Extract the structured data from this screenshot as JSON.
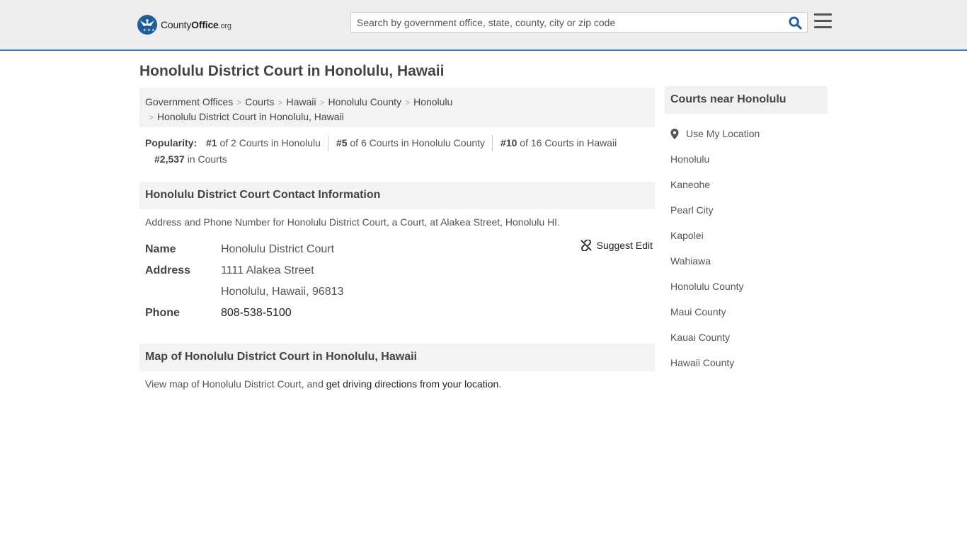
{
  "header": {
    "logo": {
      "part1": "County",
      "part2": "Office",
      "part3": ".org"
    },
    "search_placeholder": "Search by government office, state, county, city or zip code"
  },
  "page_title": "Honolulu District Court in Honolulu, Hawaii",
  "breadcrumb": {
    "items": [
      "Government Offices",
      "Courts",
      "Hawaii",
      "Honolulu County",
      "Honolulu"
    ],
    "current": "Honolulu District Court in Honolulu, Hawaii",
    "separator": ">"
  },
  "popularity": {
    "label": "Popularity:",
    "items": [
      {
        "rank": "#1",
        "text": "of 2 Courts in Honolulu"
      },
      {
        "rank": "#5",
        "text": "of 6 Courts in Honolulu County"
      },
      {
        "rank": "#10",
        "text": "of 16 Courts in Hawaii"
      },
      {
        "rank": "#2,537",
        "text": "in Courts"
      }
    ]
  },
  "contact": {
    "heading": "Honolulu District Court Contact Information",
    "description": "Address and Phone Number for Honolulu District Court, a Court, at Alakea Street, Honolulu HI.",
    "suggest_edit": "Suggest Edit",
    "name_label": "Name",
    "name": "Honolulu District Court",
    "address_label": "Address",
    "address_line1": "1111 Alakea Street",
    "address_line2": "Honolulu, Hawaii, 96813",
    "phone_label": "Phone",
    "phone": "808-538-5100"
  },
  "map": {
    "heading": "Map of Honolulu District Court in Honolulu, Hawaii",
    "desc_prefix": "View map of Honolulu District Court, and ",
    "desc_link": "get driving directions from your location",
    "desc_suffix": "."
  },
  "sidebar": {
    "heading": "Courts near Honolulu",
    "use_location": "Use My Location",
    "items": [
      "Honolulu",
      "Kaneohe",
      "Pearl City",
      "Kapolei",
      "Wahiawa",
      "Honolulu County",
      "Maui County",
      "Kauai County",
      "Hawaii County"
    ]
  },
  "colors": {
    "brand": "#1f5d9c",
    "accent_line": "#3d76b3",
    "search_icon": "#1f5d9c"
  }
}
